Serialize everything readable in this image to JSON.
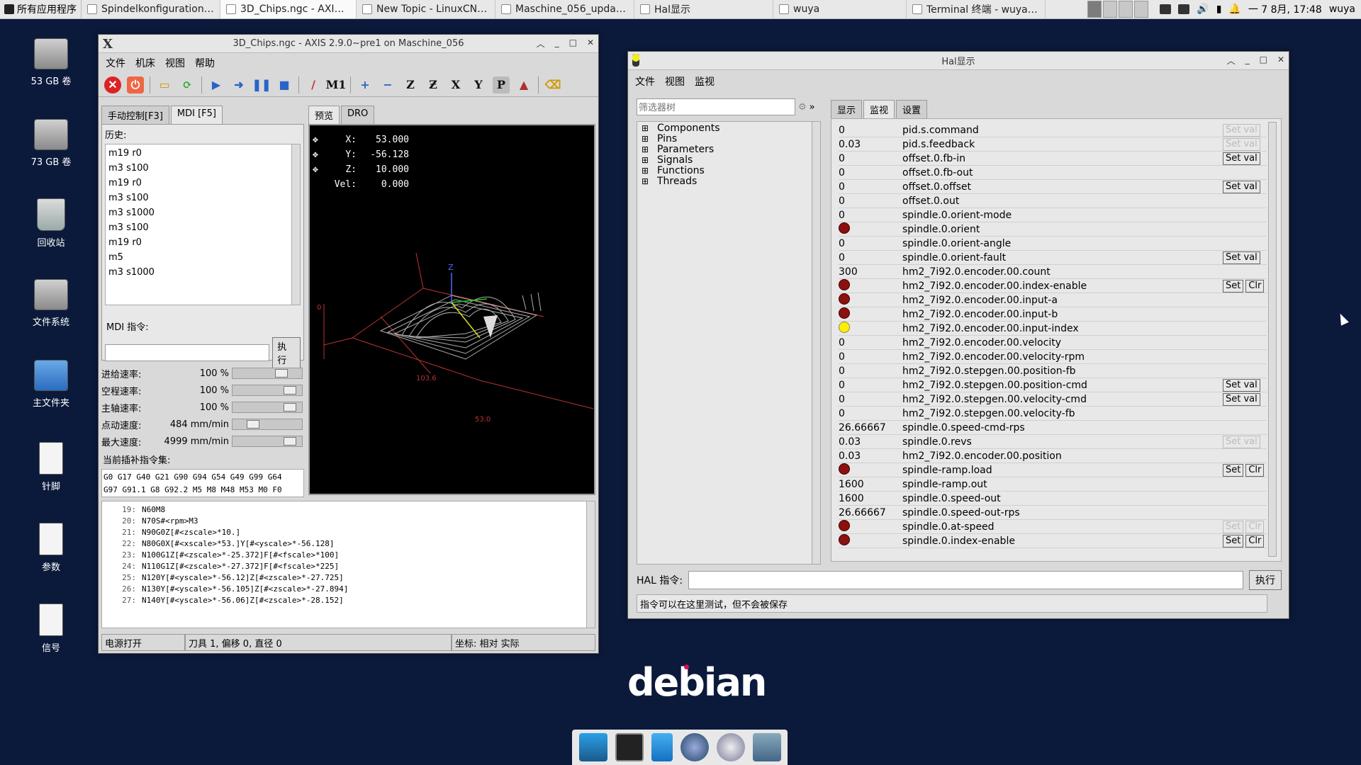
{
  "taskbar": {
    "start_label": "所有应用程序",
    "tasks": [
      {
        "label": "Spindelkonfiguration_7-..."
      },
      {
        "label": "3D_Chips.ngc - AXIS 2.9...."
      },
      {
        "label": "New Topic - LinuxCNC ..."
      },
      {
        "label": "Maschine_056_update...."
      },
      {
        "label": "Hal显示"
      },
      {
        "label": "wuya"
      },
      {
        "label": "Terminal 终端 - wuya@..."
      }
    ],
    "clock": "一 7 8月, 17:48",
    "user": "wuya"
  },
  "desktop": {
    "icons": [
      {
        "label": "53 GB 卷",
        "icon": "drive-icon"
      },
      {
        "label": "73 GB 卷",
        "icon": "drive-icon"
      },
      {
        "label": "回收站",
        "icon": "trash-icon"
      },
      {
        "label": "文件系统",
        "icon": "drive-icon"
      },
      {
        "label": "主文件夹",
        "icon": "home-folder-icon"
      },
      {
        "label": "针脚",
        "icon": "document-icon"
      },
      {
        "label": "参数",
        "icon": "document-icon"
      },
      {
        "label": "信号",
        "icon": "document-icon"
      }
    ],
    "logo_text": "debian",
    "logo_color": "#ffffff",
    "logo_dot_color": "#d70a53"
  },
  "axis": {
    "title": "3D_Chips.ngc - AXIS 2.9.0~pre1 on Maschine_056",
    "menu": [
      "文件",
      "机床",
      "视图",
      "帮助"
    ],
    "tabs_left": [
      "手动控制[F3]",
      "MDI [F5]"
    ],
    "tabs_right": [
      "预览",
      "DRO"
    ],
    "history_label": "历史:",
    "history": [
      "m19 r0",
      "m3 s100",
      "m19 r0",
      "m3 s100",
      "m3 s1000",
      "m3 s100",
      "m19 r0",
      "m5",
      "m3 s1000"
    ],
    "mdi_label": "MDI 指令:",
    "mdi_value": "",
    "exec_label": "执行",
    "rates": [
      {
        "label": "进给速率:",
        "value": "100 %",
        "level": 0.75
      },
      {
        "label": "空程速率:",
        "value": "100 %",
        "level": 0.9
      },
      {
        "label": "主轴速率:",
        "value": "100 %",
        "level": 0.9
      },
      {
        "label": "点动速度:",
        "value": "484 mm/min",
        "level": 0.25
      },
      {
        "label": "最大速度:",
        "value": "4999 mm/min",
        "level": 0.9
      }
    ],
    "gcode_label": "当前插补指令集:",
    "gcode_lines": [
      "G0 G17 G40 G21 G90 G94 G54 G49 G99 G64",
      "G97 G91.1 G8 G92.2 M5 M8 M48 M53 M0 F0"
    ],
    "dro": [
      {
        "axis": "X:",
        "value": "53.000"
      },
      {
        "axis": "Y:",
        "value": "-56.128"
      },
      {
        "axis": "Z:",
        "value": "10.000"
      },
      {
        "axis": "Vel:",
        "value": "0.000"
      }
    ],
    "program": [
      {
        "n": "19:",
        "code": "N60M8"
      },
      {
        "n": "20:",
        "code": "N70S#<rpm>M3"
      },
      {
        "n": "21:",
        "code": "N90G0Z[#<zscale>*10.]"
      },
      {
        "n": "22:",
        "code": "N80G0X[#<xscale>*53.]Y[#<yscale>*-56.128]"
      },
      {
        "n": "23:",
        "code": "N100G1Z[#<zscale>*-25.372]F[#<fscale>*100]"
      },
      {
        "n": "24:",
        "code": "N110G1Z[#<zscale>*-27.372]F[#<fscale>*225]"
      },
      {
        "n": "25:",
        "code": "N120Y[#<yscale>*-56.12]Z[#<zscale>*-27.725]"
      },
      {
        "n": "26:",
        "code": "N130Y[#<yscale>*-56.105]Z[#<zscale>*-27.894]"
      },
      {
        "n": "27:",
        "code": "N140Y[#<yscale>*-56.06]Z[#<zscale>*-28.152]"
      }
    ],
    "status": {
      "power": "电源打开",
      "tool": "刀具 1, 偏移 0, 直径 0",
      "coords": "坐标: 相对 实际"
    }
  },
  "hal": {
    "title": "Hal显示",
    "menu": [
      "文件",
      "视图",
      "监视"
    ],
    "filter_placeholder": "筛选器树",
    "tree": [
      "Components",
      "Pins",
      "Parameters",
      "Signals",
      "Functions",
      "Threads"
    ],
    "tabs": [
      "显示",
      "监视",
      "设置"
    ],
    "rows": [
      {
        "value": "0",
        "name": "pid.s.command",
        "buttons": [
          "Set val"
        ],
        "disabled": true
      },
      {
        "value": "0.03",
        "name": "pid.s.feedback",
        "buttons": [
          "Set val"
        ],
        "disabled": true
      },
      {
        "value": "0",
        "name": "offset.0.fb-in",
        "buttons": [
          "Set val"
        ],
        "disabled": false
      },
      {
        "value": "0",
        "name": "offset.0.fb-out",
        "buttons": [],
        "disabled": false
      },
      {
        "value": "0",
        "name": "offset.0.offset",
        "buttons": [
          "Set val"
        ],
        "disabled": false
      },
      {
        "value": "0",
        "name": "offset.0.out",
        "buttons": [],
        "disabled": false
      },
      {
        "value": "0",
        "name": "spindle.0.orient-mode",
        "buttons": [],
        "disabled": false
      },
      {
        "led": "red",
        "name": "spindle.0.orient",
        "buttons": [],
        "disabled": false
      },
      {
        "value": "0",
        "name": "spindle.0.orient-angle",
        "buttons": [],
        "disabled": false
      },
      {
        "value": "0",
        "name": "spindle.0.orient-fault",
        "buttons": [
          "Set val"
        ],
        "disabled": false
      },
      {
        "value": "300",
        "name": "hm2_7i92.0.encoder.00.count",
        "buttons": [],
        "disabled": false
      },
      {
        "led": "red",
        "name": "hm2_7i92.0.encoder.00.index-enable",
        "buttons": [
          "Set",
          "Clr"
        ],
        "disabled": false
      },
      {
        "led": "red",
        "name": "hm2_7i92.0.encoder.00.input-a",
        "buttons": [],
        "disabled": false
      },
      {
        "led": "red",
        "name": "hm2_7i92.0.encoder.00.input-b",
        "buttons": [],
        "disabled": false
      },
      {
        "led": "yellow",
        "name": "hm2_7i92.0.encoder.00.input-index",
        "buttons": [],
        "disabled": false
      },
      {
        "value": "0",
        "name": "hm2_7i92.0.encoder.00.velocity",
        "buttons": [],
        "disabled": false
      },
      {
        "value": "0",
        "name": "hm2_7i92.0.encoder.00.velocity-rpm",
        "buttons": [],
        "disabled": false
      },
      {
        "value": "0",
        "name": "hm2_7i92.0.stepgen.00.position-fb",
        "buttons": [],
        "disabled": false
      },
      {
        "value": "0",
        "name": "hm2_7i92.0.stepgen.00.position-cmd",
        "buttons": [
          "Set val"
        ],
        "disabled": false
      },
      {
        "value": "0",
        "name": "hm2_7i92.0.stepgen.00.velocity-cmd",
        "buttons": [
          "Set val"
        ],
        "disabled": false
      },
      {
        "value": "0",
        "name": "hm2_7i92.0.stepgen.00.velocity-fb",
        "buttons": [],
        "disabled": false
      },
      {
        "value": "26.66667",
        "name": "spindle.0.speed-cmd-rps",
        "buttons": [],
        "disabled": false
      },
      {
        "value": "0.03",
        "name": "spindle.0.revs",
        "buttons": [
          "Set val"
        ],
        "disabled": true
      },
      {
        "value": "0.03",
        "name": "hm2_7i92.0.encoder.00.position",
        "buttons": [],
        "disabled": false
      },
      {
        "led": "red",
        "name": "spindle-ramp.load",
        "buttons": [
          "Set",
          "Clr"
        ],
        "disabled": false
      },
      {
        "value": "1600",
        "name": "spindle-ramp.out",
        "buttons": [],
        "disabled": false
      },
      {
        "value": "1600",
        "name": "spindle.0.speed-out",
        "buttons": [],
        "disabled": false
      },
      {
        "value": "26.66667",
        "name": "spindle.0.speed-out-rps",
        "buttons": [],
        "disabled": false
      },
      {
        "led": "red",
        "name": "spindle.0.at-speed",
        "buttons": [
          "Set",
          "Clr"
        ],
        "disabled": true
      },
      {
        "led": "red",
        "name": "spindle.0.index-enable",
        "buttons": [
          "Set",
          "Clr"
        ],
        "disabled": false
      }
    ],
    "cmd_label": "HAL 指令:",
    "cmd_value": "",
    "exec_label": "执行",
    "status": "指令可以在这里测试，但不会被保存"
  }
}
